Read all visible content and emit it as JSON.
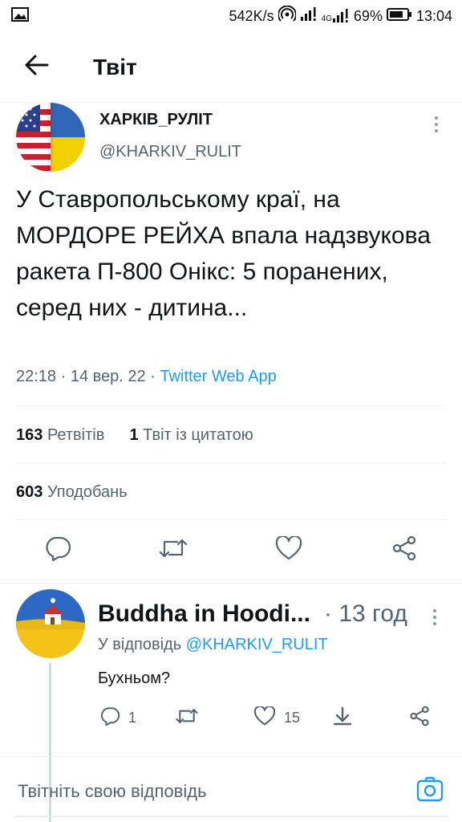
{
  "status_bar": {
    "net_speed": "542K/s",
    "network_type": "4G",
    "battery": "69%",
    "time": "13:04",
    "icons": [
      "image-icon",
      "hotspot-icon",
      "signal-icon",
      "signal-4g-icon",
      "battery-icon"
    ]
  },
  "header": {
    "title": "Твіт",
    "back_icon": "arrow-left-icon"
  },
  "tweet": {
    "author_name": "ХАРКІВ_РУЛІТ",
    "author_handle": "@KHARKIV_RULIT",
    "text": "У Ставропольському краї, на МОРДОРЕ РЕЙХА впала надзвукова ракета П-800 Онікс: 5 поранених, серед них - дитина...",
    "time": "22:18",
    "date": "14 вер. 22",
    "source": "Twitter Web App",
    "retweets_count": "163",
    "retweets_label": "Ретвітів",
    "quotes_count": "1",
    "quotes_label": "Твіт із цитатою",
    "likes_count": "603",
    "likes_label": "Уподобань"
  },
  "reply": {
    "author_name": "Buddha in Hoodi...",
    "time": "· 13 год",
    "reply_to_label": "У відповідь",
    "reply_to_handle": "@KHARKIV_RULIT",
    "text": "Бухньом?",
    "reply_count": "1",
    "like_count": "15"
  },
  "compose": {
    "placeholder": "Твітніть свою відповідь"
  },
  "colors": {
    "accent": "#1d9bf0",
    "text": "#0f1419",
    "secondary": "#536471",
    "divider": "#eff3f4"
  }
}
